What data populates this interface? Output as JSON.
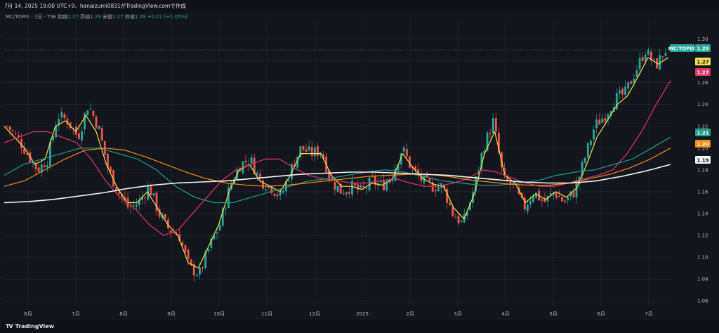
{
  "header": {
    "snapshot_text": "7月 14, 2025 19:00 UTC+9、hanaizumi0831がTradingView.comで作成"
  },
  "legend": {
    "symbol": "MC/TOPIX · 1日 · TSE",
    "open_label": "始値",
    "open": "1.27",
    "high_label": "高値",
    "high": "1.29",
    "low_label": "安値",
    "low": "1.27",
    "close_label": "終値",
    "close": "1.29",
    "change": "+0.01 (+1.05%)"
  },
  "branding": {
    "logo_text": "TV",
    "name": "TradingView"
  },
  "colors": {
    "background": "#14161d",
    "grid": "#2a2e39",
    "up": "#26a69a",
    "down": "#ef5350",
    "ma_short": "#f0e24a",
    "ma_mid": "#e2336b",
    "ma_teal": "#1f9c8c",
    "ma_orange": "#f08c1a",
    "ma_long": "#f2f2f2"
  },
  "chart_data": {
    "type": "candlestick",
    "title": "",
    "xlabel": "",
    "ylabel": "",
    "x_tick_labels": [
      "6月",
      "7月",
      "8月",
      "9月",
      "10月",
      "11月",
      "12月",
      "2025",
      "2月",
      "3月",
      "4月",
      "5月",
      "6月",
      "7月"
    ],
    "y_ticks": [
      1.06,
      1.08,
      1.1,
      1.12,
      1.14,
      1.16,
      1.18,
      1.2,
      1.22,
      1.24,
      1.26,
      1.28,
      1.3
    ],
    "ylim": [
      1.055,
      1.31
    ],
    "grid": true,
    "price_tags": [
      {
        "label": "MC/TOPIX",
        "value": "1.29",
        "color": "#26a69a"
      },
      {
        "label": "",
        "value": "1.27",
        "color": "#f0e24a"
      },
      {
        "label": "",
        "value": "1.27",
        "color": "#e2336b"
      },
      {
        "label": "",
        "value": "1.21",
        "color": "#1f9c8c"
      },
      {
        "label": "",
        "value": "1.20",
        "color": "#f08c1a"
      },
      {
        "label": "",
        "value": "1.19",
        "color": "#f2f2f2"
      }
    ],
    "close_anchors": [
      1.22,
      1.21,
      1.195,
      1.18,
      1.19,
      1.23,
      1.225,
      1.21,
      1.24,
      1.22,
      1.18,
      1.16,
      1.145,
      1.15,
      1.165,
      1.14,
      1.125,
      1.12,
      1.09,
      1.085,
      1.11,
      1.13,
      1.165,
      1.185,
      1.19,
      1.17,
      1.165,
      1.155,
      1.18,
      1.2,
      1.195,
      1.198,
      1.17,
      1.16,
      1.165,
      1.16,
      1.17,
      1.165,
      1.175,
      1.2,
      1.18,
      1.17,
      1.165,
      1.165,
      1.14,
      1.13,
      1.16,
      1.2,
      1.225,
      1.17,
      1.165,
      1.145,
      1.16,
      1.15,
      1.16,
      1.15,
      1.16,
      1.19,
      1.22,
      1.23,
      1.245,
      1.25,
      1.27,
      1.29,
      1.275,
      1.29
    ],
    "series": [
      {
        "key": "ma_short",
        "points": [
          1.22,
          1.21,
          1.2,
          1.185,
          1.19,
          1.22,
          1.225,
          1.215,
          1.23,
          1.215,
          1.185,
          1.165,
          1.15,
          1.15,
          1.16,
          1.145,
          1.13,
          1.12,
          1.095,
          1.09,
          1.11,
          1.13,
          1.16,
          1.18,
          1.185,
          1.17,
          1.165,
          1.16,
          1.175,
          1.195,
          1.195,
          1.195,
          1.175,
          1.165,
          1.165,
          1.162,
          1.168,
          1.166,
          1.172,
          1.195,
          1.182,
          1.172,
          1.167,
          1.165,
          1.145,
          1.135,
          1.158,
          1.195,
          1.215,
          1.175,
          1.168,
          1.15,
          1.158,
          1.153,
          1.16,
          1.155,
          1.163,
          1.185,
          1.21,
          1.225,
          1.24,
          1.248,
          1.265,
          1.283,
          1.277,
          1.283
        ]
      },
      {
        "key": "ma_mid",
        "points": [
          1.205,
          1.21,
          1.215,
          1.215,
          1.21,
          1.205,
          1.19,
          1.17,
          1.155,
          1.145,
          1.13,
          1.12,
          1.125,
          1.14,
          1.155,
          1.17,
          1.18,
          1.185,
          1.19,
          1.19,
          1.182,
          1.175,
          1.172,
          1.17,
          1.168,
          1.168,
          1.17,
          1.172,
          1.168,
          1.165,
          1.165,
          1.168,
          1.172,
          1.18,
          1.178,
          1.173,
          1.168,
          1.165,
          1.165,
          1.168,
          1.172,
          1.175,
          1.18,
          1.195,
          1.215,
          1.24,
          1.262
        ]
      },
      {
        "key": "ma_teal",
        "points": [
          1.175,
          1.185,
          1.19,
          1.195,
          1.2,
          1.2,
          1.195,
          1.19,
          1.18,
          1.165,
          1.155,
          1.15,
          1.15,
          1.155,
          1.16,
          1.165,
          1.17,
          1.172,
          1.175,
          1.178,
          1.18,
          1.178,
          1.174,
          1.17,
          1.168,
          1.166,
          1.166,
          1.168,
          1.17,
          1.175,
          1.178,
          1.18,
          1.185,
          1.19,
          1.2,
          1.21
        ]
      },
      {
        "key": "ma_orange",
        "points": [
          1.165,
          1.17,
          1.18,
          1.19,
          1.198,
          1.2,
          1.198,
          1.192,
          1.185,
          1.178,
          1.172,
          1.168,
          1.166,
          1.165,
          1.166,
          1.168,
          1.17,
          1.172,
          1.174,
          1.175,
          1.176,
          1.176,
          1.174,
          1.171,
          1.169,
          1.167,
          1.166,
          1.166,
          1.168,
          1.172,
          1.176,
          1.182,
          1.19,
          1.2
        ]
      },
      {
        "key": "ma_long",
        "points": [
          1.15,
          1.151,
          1.153,
          1.156,
          1.159,
          1.163,
          1.166,
          1.168,
          1.169,
          1.17,
          1.172,
          1.174,
          1.176,
          1.177,
          1.178,
          1.178,
          1.177,
          1.176,
          1.175,
          1.173,
          1.171,
          1.169,
          1.168,
          1.168,
          1.17,
          1.174,
          1.179,
          1.185
        ]
      }
    ]
  }
}
